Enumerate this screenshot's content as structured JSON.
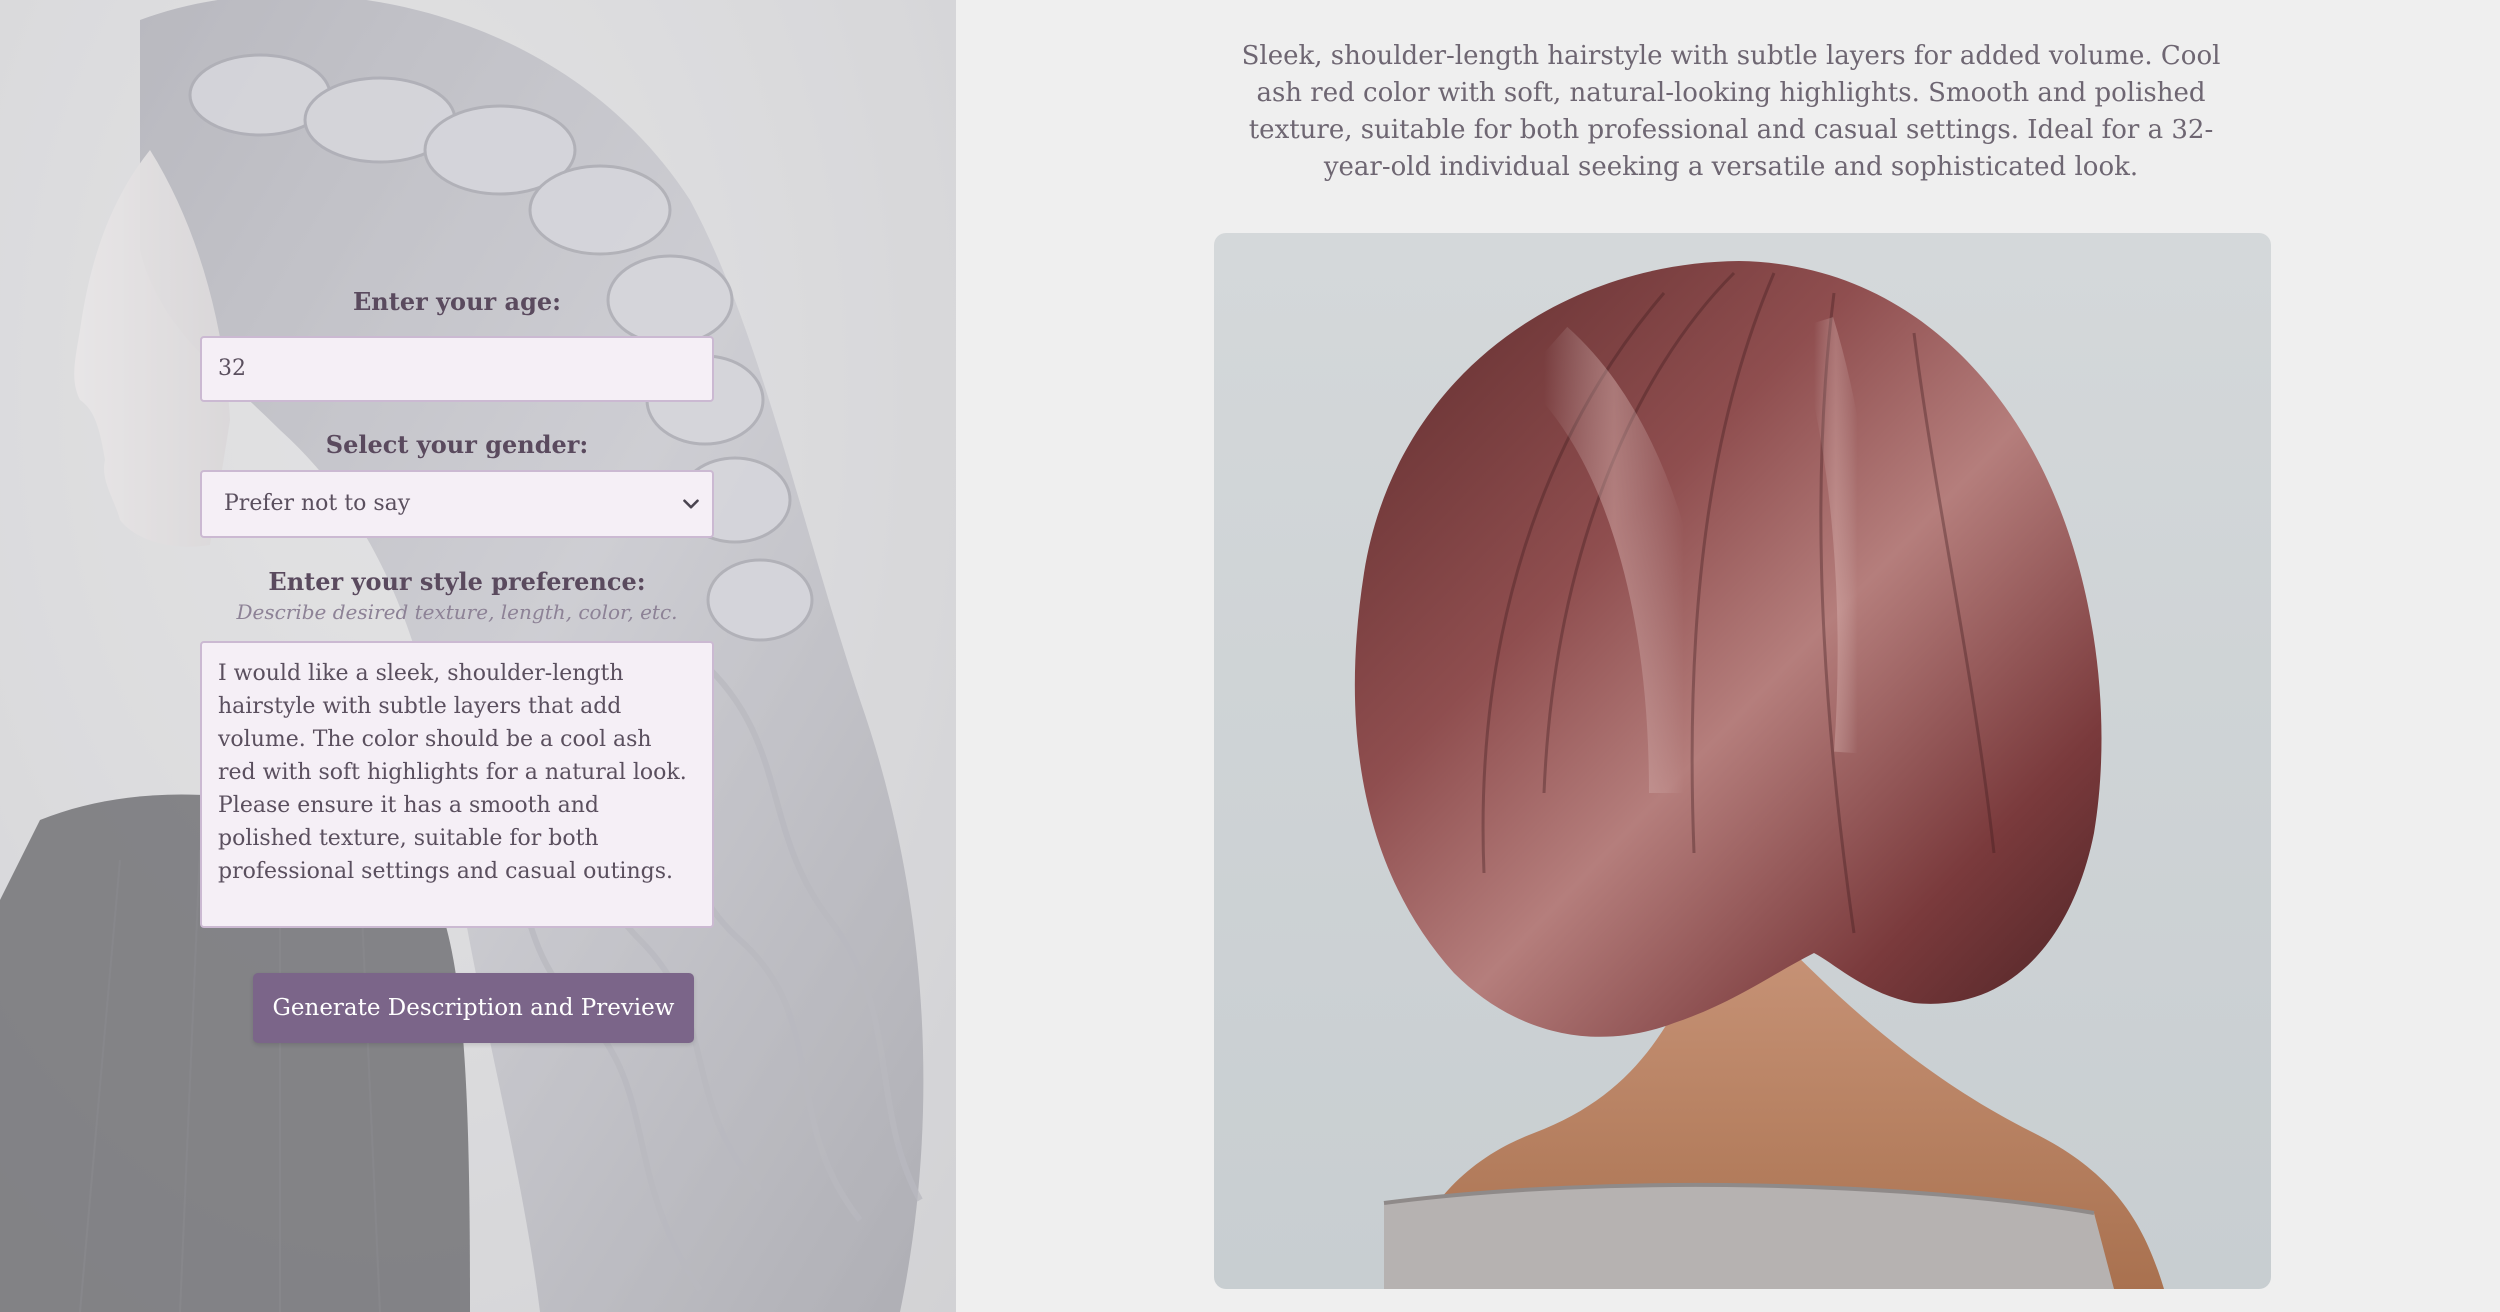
{
  "form": {
    "age_label": "Enter your age:",
    "age_value": "32",
    "gender_label": "Select your gender:",
    "gender_selected": "Prefer not to say",
    "style_label": "Enter your style preference:",
    "style_hint": "Describe desired texture, length, color, etc.",
    "style_value": "I would like a sleek, shoulder-length hairstyle with subtle layers that add volume. The color should be a cool ash red with soft highlights for a natural look. Please ensure it has a smooth and polished texture, suitable for both professional settings and casual outings.",
    "generate_button": "Generate Description and Preview"
  },
  "result": {
    "description": "Sleek, shoulder-length hairstyle with subtle layers for added volume. Cool ash red color with soft, natural-looking highlights. Smooth and polished texture, suitable for both professional and casual settings. Ideal for a 32-year-old individual seeking a versatile and sophisticated look."
  },
  "colors": {
    "accent": "#7b6589",
    "label_text": "#5a4a5e",
    "field_background": "#f5eff6",
    "page_background": "#efefef"
  },
  "icons": {
    "select_chevron": "chevron-down-icon"
  }
}
